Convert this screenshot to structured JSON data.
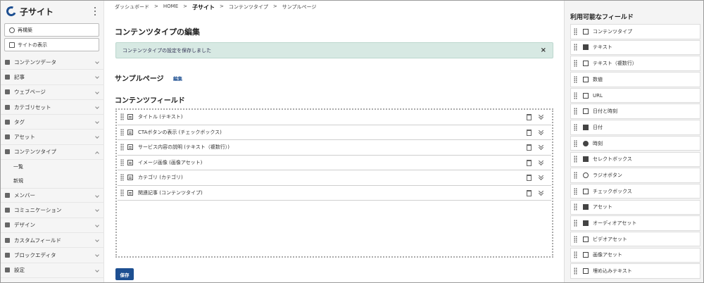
{
  "sidebar": {
    "site_name": "子サイト",
    "buttons": [
      {
        "label": "再構築",
        "icon": "refresh-icon"
      },
      {
        "label": "サイトの表示",
        "icon": "external-link-icon"
      }
    ],
    "items": [
      {
        "label": "コンテンツデータ",
        "icon": "content-data-icon"
      },
      {
        "label": "記事",
        "icon": "entry-icon"
      },
      {
        "label": "ウェブページ",
        "icon": "page-icon"
      },
      {
        "label": "カテゴリセット",
        "icon": "category-set-icon"
      },
      {
        "label": "タグ",
        "icon": "tag-icon"
      },
      {
        "label": "アセット",
        "icon": "asset-icon"
      },
      {
        "label": "コンテンツタイプ",
        "icon": "content-type-icon",
        "expanded": true
      }
    ],
    "sub_items": [
      {
        "label": "一覧"
      },
      {
        "label": "新規"
      }
    ],
    "items_after": [
      {
        "label": "メンバー",
        "icon": "member-icon"
      },
      {
        "label": "コミュニケーション",
        "icon": "communication-icon"
      },
      {
        "label": "デザイン",
        "icon": "design-icon"
      },
      {
        "label": "カスタムフィールド",
        "icon": "custom-field-icon"
      },
      {
        "label": "ブロックエディタ",
        "icon": "block-editor-icon"
      },
      {
        "label": "設定",
        "icon": "gear-icon"
      }
    ]
  },
  "breadcrumb": [
    "ダッシュボード",
    "HOME",
    "子サイト",
    "コンテンツタイプ",
    "サンプルページ"
  ],
  "main": {
    "title": "コンテンツタイプの編集",
    "alert": "コンテンツタイプの設定を保存しました",
    "alert_close": "×",
    "content_type_name": "サンプルページ",
    "edit_link": "編集",
    "fields_heading": "コンテンツフィールド",
    "fields": [
      {
        "label": "タイトル (テキスト)"
      },
      {
        "label": "CTAボタンの表示 (チェックボックス)"
      },
      {
        "label": "サービス内容の説明 (テキスト（複数行）)"
      },
      {
        "label": "イメージ画像 (画像アセット)"
      },
      {
        "label": "カテゴリ (カテゴリ)"
      },
      {
        "label": "関連記事 (コンテンツタイプ)"
      }
    ],
    "save_label": "保存"
  },
  "right_panel": {
    "title": "利用可能なフィールド",
    "items": [
      {
        "label": "コンテンツタイプ",
        "icon": "content-type-icon"
      },
      {
        "label": "テキスト",
        "icon": "text-icon"
      },
      {
        "label": "テキスト（複数行）",
        "icon": "multiline-text-icon"
      },
      {
        "label": "数値",
        "icon": "number-icon"
      },
      {
        "label": "URL",
        "icon": "url-icon"
      },
      {
        "label": "日付と時刻",
        "icon": "datetime-icon"
      },
      {
        "label": "日付",
        "icon": "calendar-icon"
      },
      {
        "label": "時刻",
        "icon": "clock-icon"
      },
      {
        "label": "セレクトボックス",
        "icon": "select-icon"
      },
      {
        "label": "ラジオボタン",
        "icon": "radio-icon"
      },
      {
        "label": "チェックボックス",
        "icon": "checkbox-icon"
      },
      {
        "label": "アセット",
        "icon": "asset-icon"
      },
      {
        "label": "オーディオアセット",
        "icon": "audio-icon"
      },
      {
        "label": "ビデオアセット",
        "icon": "video-icon"
      },
      {
        "label": "画像アセット",
        "icon": "image-icon"
      },
      {
        "label": "埋め込みテキスト",
        "icon": "embed-text-icon"
      }
    ]
  }
}
